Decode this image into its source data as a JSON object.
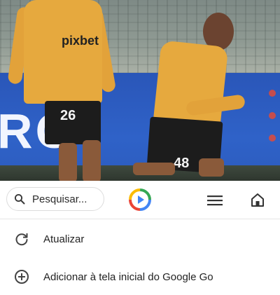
{
  "photo": {
    "board_text": "RO",
    "left_player": {
      "sponsor": "pixbet",
      "number": "26"
    },
    "right_player": {
      "number": "48"
    }
  },
  "toolbar": {
    "search_placeholder": "Pesquisar...",
    "icons": [
      "search-icon",
      "google-go-logo-icon",
      "menu-icon",
      "home-icon"
    ]
  },
  "menu": {
    "items": [
      {
        "label": "Atualizar",
        "icon": "refresh-icon"
      },
      {
        "label": "Adicionar à tela inicial do Google Go",
        "icon": "add-circle-icon"
      }
    ]
  },
  "colors": {
    "jersey": "#e6a93e",
    "board_blue": "#2f62c8",
    "go_logo_blue": "#4285f4",
    "go_logo_red": "#ea4335",
    "go_logo_yellow": "#fbbc05",
    "go_logo_green": "#34a853"
  }
}
